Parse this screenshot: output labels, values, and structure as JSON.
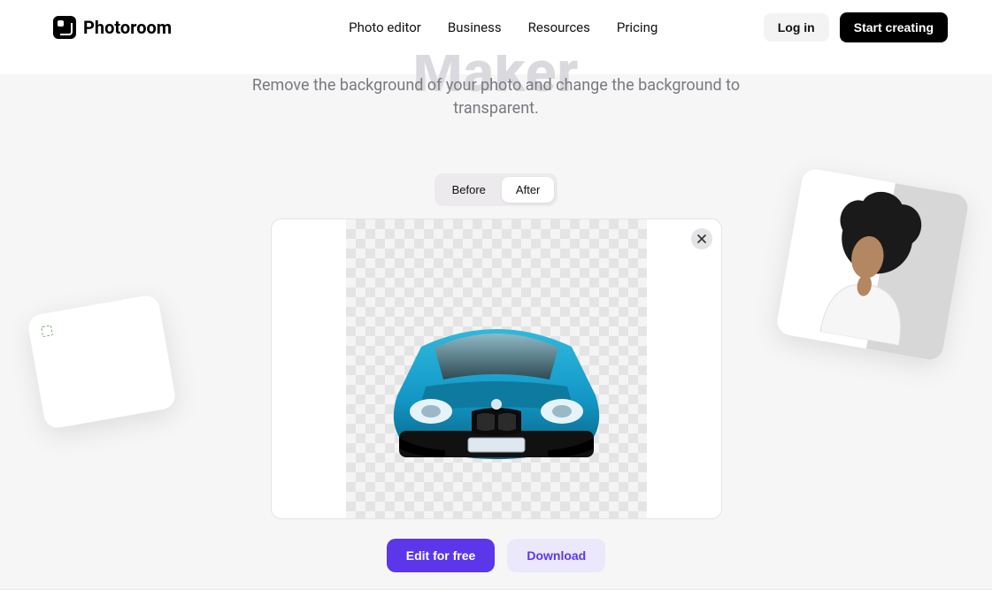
{
  "brand": "Photoroom",
  "nav": {
    "photo_editor": "Photo editor",
    "business": "Business",
    "resources": "Resources",
    "pricing": "Pricing"
  },
  "auth": {
    "login": "Log in",
    "start": "Start creating"
  },
  "hero": {
    "ghost_title": "Maker",
    "subtitle": "Remove the background of your photo and change the background to transparent."
  },
  "toggle": {
    "before": "Before",
    "after": "After",
    "active": "after"
  },
  "actions": {
    "edit": "Edit for free",
    "download": "Download"
  },
  "colors": {
    "primary": "#5b36ea",
    "primary_soft": "#ece8fb",
    "car": "#1296c5"
  }
}
